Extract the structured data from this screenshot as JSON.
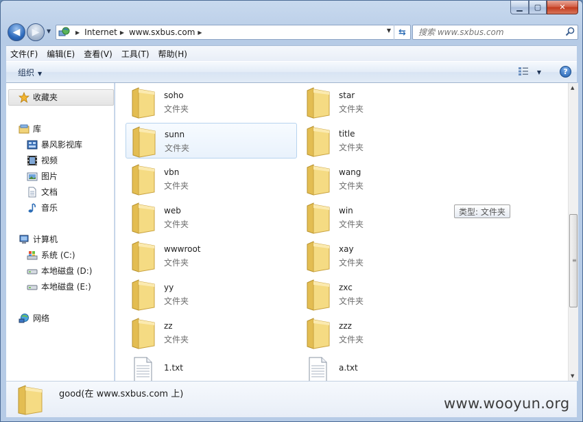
{
  "address": {
    "crumbs": [
      "Internet",
      "www.sxbus.com"
    ]
  },
  "search": {
    "placeholder": "搜索 www.sxbus.com"
  },
  "menu": [
    "文件(F)",
    "编辑(E)",
    "查看(V)",
    "工具(T)",
    "帮助(H)"
  ],
  "toolbar": {
    "organize_label": "组织"
  },
  "nav": {
    "favorites": "收藏夹",
    "libraries": "库",
    "library_items": [
      "暴风影视库",
      "视频",
      "图片",
      "文档",
      "音乐"
    ],
    "computer": "计算机",
    "drives": [
      "系统 (C:)",
      "本地磁盘 (D:)",
      "本地磁盘 (E:)"
    ],
    "network": "网络"
  },
  "files": {
    "type_label": "文件夹",
    "items": [
      {
        "name": "soho",
        "kind": "folder",
        "selected": false
      },
      {
        "name": "star",
        "kind": "folder",
        "selected": false
      },
      {
        "name": "sunn",
        "kind": "folder",
        "selected": true
      },
      {
        "name": "title",
        "kind": "folder",
        "selected": false
      },
      {
        "name": "vbn",
        "kind": "folder",
        "selected": false
      },
      {
        "name": "wang",
        "kind": "folder",
        "selected": false
      },
      {
        "name": "web",
        "kind": "folder",
        "selected": false
      },
      {
        "name": "win",
        "kind": "folder",
        "selected": false
      },
      {
        "name": "wwwroot",
        "kind": "folder",
        "selected": false
      },
      {
        "name": "xay",
        "kind": "folder",
        "selected": false
      },
      {
        "name": "yy",
        "kind": "folder",
        "selected": false
      },
      {
        "name": "zxc",
        "kind": "folder",
        "selected": false
      },
      {
        "name": "zz",
        "kind": "folder",
        "selected": false
      },
      {
        "name": "zzz",
        "kind": "folder",
        "selected": false
      },
      {
        "name": "1.txt",
        "kind": "txt",
        "selected": false
      },
      {
        "name": "a.txt",
        "kind": "txt",
        "selected": false
      }
    ]
  },
  "tooltip": "类型: 文件夹",
  "details": {
    "title": "good(在 www.sxbus.com 上)"
  },
  "watermark": "www.wooyun.org",
  "colors": {
    "folder": "#f3d77b",
    "accent": "#2e6bbd",
    "selection": "#e9f2fc"
  }
}
